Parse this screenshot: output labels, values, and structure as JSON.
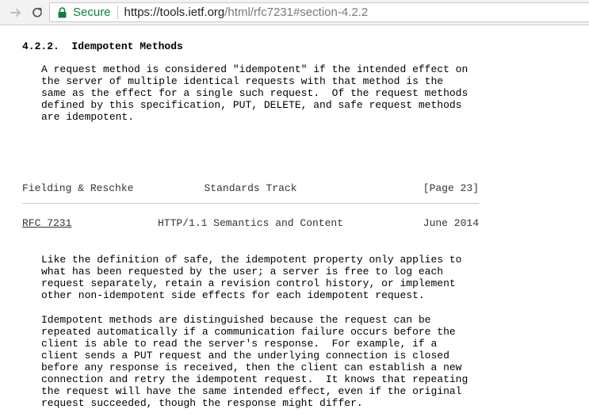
{
  "browser": {
    "secure_label": "Secure",
    "url_host": "https://tools.ietf.org",
    "url_rest": "/html/rfc7231#section-4.2.2"
  },
  "doc": {
    "section_heading": "4.2.2.  Idempotent Methods",
    "para1": "A request method is considered \"idempotent\" if the intended effect on\nthe server of multiple identical requests with that method is the\nsame as the effect for a single such request.  Of the request methods\ndefined by this specification, PUT, DELETE, and safe request methods\nare idempotent.",
    "footer": {
      "left": "Fielding & Reschke",
      "center": "Standards Track",
      "right": "[Page 23]"
    },
    "header": {
      "rfc_link": "RFC 7231",
      "center": "HTTP/1.1 Semantics and Content",
      "right": "June 2014"
    },
    "para2": "Like the definition of safe, the idempotent property only applies to\nwhat has been requested by the user; a server is free to log each\nrequest separately, retain a revision control history, or implement\nother non-idempotent side effects for each idempotent request.",
    "para3": "Idempotent methods are distinguished because the request can be\nrepeated automatically if a communication failure occurs before the\nclient is able to read the server's response.  For example, if a\nclient sends a PUT request and the underlying connection is closed\nbefore any response is received, then the client can establish a new\nconnection and retry the idempotent request.  It knows that repeating\nthe request will have the same intended effect, even if the original\nrequest succeeded, though the response might differ."
  }
}
